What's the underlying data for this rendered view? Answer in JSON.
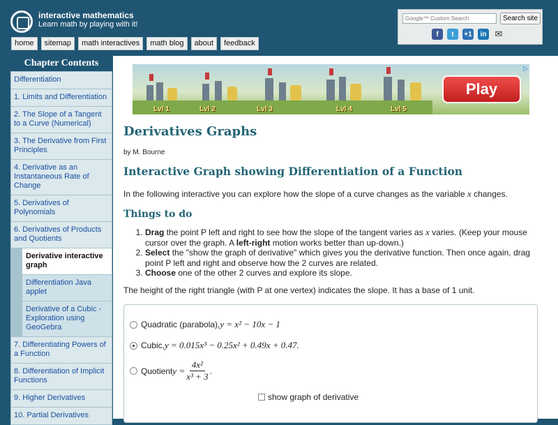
{
  "header": {
    "site_name": "interactive mathematics",
    "tagline": "Learn math by playing with it!",
    "nav": [
      "home",
      "sitemap",
      "math interactives",
      "math blog",
      "about",
      "feedback"
    ],
    "search": {
      "placeholder": "Google™ Custom Search",
      "button": "Search site"
    },
    "social_icons": [
      "facebook-icon",
      "twitter-icon",
      "google-plus-icon",
      "linkedin-icon",
      "email-icon"
    ]
  },
  "sidebar": {
    "heading": "Chapter Contents",
    "items": [
      {
        "label": "Differentiation",
        "sub": false,
        "active": false
      },
      {
        "label": "1. Limits and Differentiation",
        "sub": false,
        "active": false
      },
      {
        "label": "2. The Slope of a Tangent to a Curve (Numerical)",
        "sub": false,
        "active": false
      },
      {
        "label": "3. The Derivative from First Principles",
        "sub": false,
        "active": false
      },
      {
        "label": "4. Derivative as an Instantaneous Rate of Change",
        "sub": false,
        "active": false
      },
      {
        "label": "5. Derivatives of Polynomials",
        "sub": false,
        "active": false
      },
      {
        "label": "6. Derivatives of Products and Quotients",
        "sub": false,
        "active": false
      },
      {
        "label": "Derivative interactive graph",
        "sub": true,
        "active": true
      },
      {
        "label": "Differentiation Java applet",
        "sub": true,
        "active": false
      },
      {
        "label": "Derivative of a Cubic - Exploration using GeoGebra",
        "sub": true,
        "active": false
      },
      {
        "label": "7. Differentiating Powers of a Function",
        "sub": false,
        "active": false
      },
      {
        "label": "8. Differentiation of Implicit Functions",
        "sub": false,
        "active": false
      },
      {
        "label": "9. Higher Derivatives",
        "sub": false,
        "active": false
      },
      {
        "label": "10. Partial Derivatives",
        "sub": false,
        "active": false
      }
    ]
  },
  "ad": {
    "levels": [
      "Lvl 1",
      "Lvl 2",
      "Lvl 3",
      "Lvl 4",
      "Lvl 5"
    ],
    "play_label": "Play",
    "info_mark": "▷"
  },
  "main": {
    "title": "Derivatives Graphs",
    "byline": "by M. Bourne",
    "subtitle": "Interactive Graph showing Differentiation of a Function",
    "intro_before": "In the following interactive you can explore how the slope of a curve changes as the variable ",
    "intro_var": "x",
    "intro_after": " changes.",
    "things_heading": "Things to do",
    "step1_bold": "Drag",
    "step1_a": " the point P left and right to see how the slope of the tangent varies as ",
    "step1_var": "x",
    "step1_b": " varies. (Keep your mouse cursor over the graph. A ",
    "step1_bold2": "left-right",
    "step1_c": " motion works better than up-down.)",
    "step2_bold": "Select",
    "step2_rest": " the \"show the graph of derivative\" which gives you the derivative function. Then once again, drag point P left and right and observe how the 2 curves are related.",
    "step3_bold": "Choose",
    "step3_rest": " one of the other 2 curves and explore its slope.",
    "note": "The height of the right triangle (with P at one vertex) indicates the slope. It has a base of 1 unit."
  },
  "widget": {
    "opt1_label": "Quadratic (parabola), ",
    "opt1_math": "y = x² − 10x − 1",
    "opt2_label": "Cubic, ",
    "opt2_math": "y = 0.015x³ − 0.25x² + 0.49x + 0.47.",
    "opt3_label": "Quotient ",
    "opt3_lhs": "y =",
    "opt3_num": "4x²",
    "opt3_den": "x³ + 3",
    "opt3_end": ".",
    "selected": "cubic",
    "show_derivative_label": "show graph of derivative",
    "show_derivative_checked": false
  }
}
